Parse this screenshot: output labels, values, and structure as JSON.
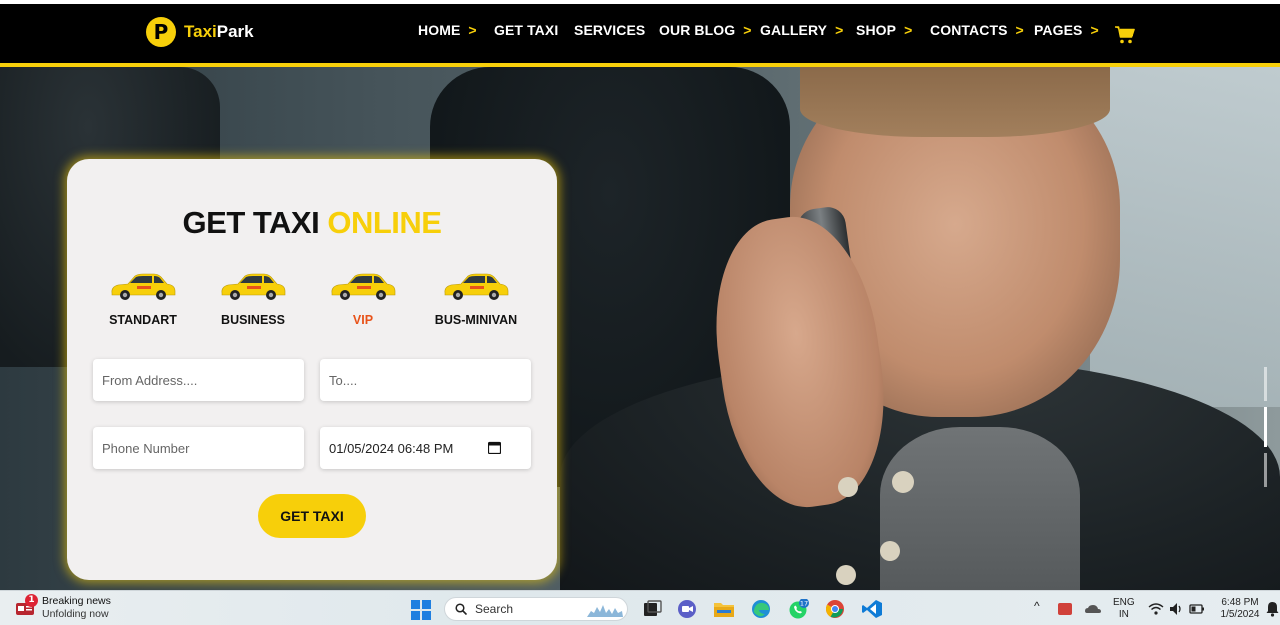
{
  "brand": {
    "name_a": "Taxi",
    "name_b": "Park",
    "logo_letter": "P"
  },
  "nav": {
    "items": [
      {
        "label": "HOME",
        "chevron": ">"
      },
      {
        "label": "GET TAXI",
        "chevron": ""
      },
      {
        "label": "SERVICES",
        "chevron": ""
      },
      {
        "label": "OUR BLOG",
        "chevron": ">"
      },
      {
        "label": "GALLERY",
        "chevron": ">"
      },
      {
        "label": "SHOP",
        "chevron": ">"
      },
      {
        "label": "CONTACTS",
        "chevron": ">"
      },
      {
        "label": "PAGES",
        "chevron": ">"
      }
    ],
    "cart_icon": "shopping-cart-icon"
  },
  "form": {
    "title_main": "GET TAXI",
    "title_accent": "ONLINE",
    "car_types": [
      {
        "label": "STANDART",
        "active": false
      },
      {
        "label": "BUSINESS",
        "active": false
      },
      {
        "label": "VIP",
        "active": true
      },
      {
        "label": "BUS-MINIVAN",
        "active": false
      }
    ],
    "car_badge": "TAXI",
    "fields": {
      "from_placeholder": "From Address....",
      "to_placeholder": "To....",
      "phone_placeholder": "Phone Number",
      "datetime_value": "01/05/2024 06:48 PM"
    },
    "submit_label": "GET TAXI"
  },
  "taskbar": {
    "news_title": "Breaking news",
    "news_sub": "Unfolding now",
    "news_badge": "1",
    "search_label": "Search",
    "whatsapp_badge": "17",
    "lang_top": "ENG",
    "lang_bottom": "IN",
    "time": "6:48 PM",
    "date": "1/5/2024"
  },
  "colors": {
    "accent": "#f7cf0a",
    "active_car": "#e8531a",
    "navbar": "#000000",
    "card_bg": "#f2f0f0"
  }
}
